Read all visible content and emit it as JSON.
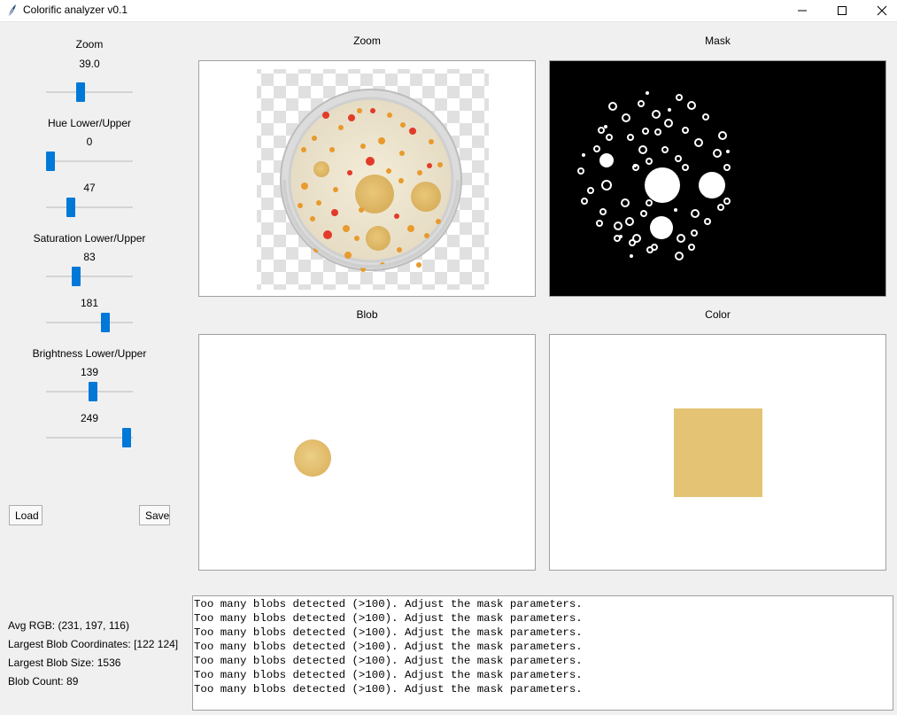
{
  "window": {
    "title": "Colorific analyzer v0.1",
    "feather_icon": "feather-icon",
    "minimize_icon": "minimize-icon",
    "maximize_icon": "maximize-icon",
    "close_icon": "close-icon"
  },
  "controls": {
    "zoom_label": "Zoom",
    "zoom_value": "39.0",
    "zoom_level": 0.39,
    "hue_label": "Hue Lower/Upper",
    "hue_lower": "0",
    "hue_lower_level": 0.0,
    "hue_upper": "47",
    "hue_upper_level": 0.26,
    "sat_label": "Saturation Lower/Upper",
    "sat_lower": "83",
    "sat_lower_level": 0.33,
    "sat_upper": "181",
    "sat_upper_level": 0.71,
    "bright_label": "Brightness Lower/Upper",
    "bright_lower": "139",
    "bright_lower_level": 0.55,
    "bright_upper": "249",
    "bright_upper_level": 0.98,
    "load_label": "Load",
    "save_label": "Save"
  },
  "panels": {
    "zoom_title": "Zoom",
    "mask_title": "Mask",
    "blob_title": "Blob",
    "color_title": "Color"
  },
  "colors": {
    "blob_color": "#e4c474",
    "accent": "#0078d7"
  },
  "stats": {
    "avg_rgb": "Avg RGB: (231, 197, 116)",
    "largest_coords": "Largest Blob Coordinates: [122 124]",
    "largest_size": "Largest Blob Size: 1536",
    "blob_count": "Blob Count: 89"
  },
  "log": {
    "lines": [
      "Too many blobs detected (>100). Adjust the mask parameters.",
      "Too many blobs detected (>100). Adjust the mask parameters.",
      "Too many blobs detected (>100). Adjust the mask parameters.",
      "Too many blobs detected (>100). Adjust the mask parameters.",
      "Too many blobs detected (>100). Adjust the mask parameters.",
      "Too many blobs detected (>100). Adjust the mask parameters.",
      "Too many blobs detected (>100). Adjust the mask parameters."
    ]
  }
}
